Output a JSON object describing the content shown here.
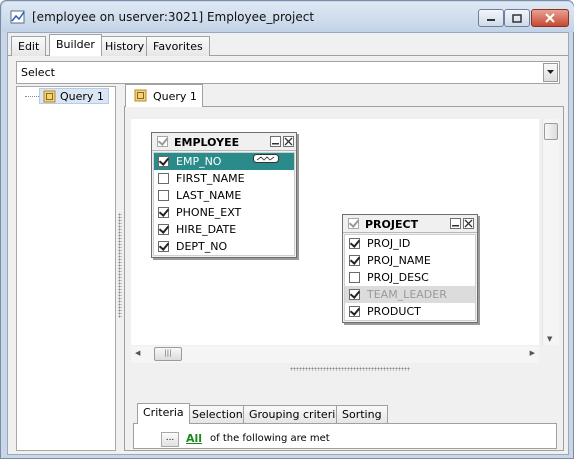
{
  "window": {
    "title": "[employee on userver:3021] Employee_project"
  },
  "tabs": [
    {
      "label": "Edit"
    },
    {
      "label": "Builder",
      "active": true
    },
    {
      "label": "History"
    },
    {
      "label": "Favorites"
    }
  ],
  "query_type": {
    "value": "Select"
  },
  "tree": {
    "items": [
      {
        "label": "Query 1"
      }
    ]
  },
  "query_tab": {
    "label": "Query 1"
  },
  "tables": [
    {
      "name": "EMPLOYEE",
      "fields": [
        {
          "name": "EMP_NO",
          "checked": true,
          "selected": true
        },
        {
          "name": "FIRST_NAME",
          "checked": false
        },
        {
          "name": "LAST_NAME",
          "checked": false
        },
        {
          "name": "PHONE_EXT",
          "checked": true
        },
        {
          "name": "HIRE_DATE",
          "checked": true
        },
        {
          "name": "DEPT_NO",
          "checked": true
        }
      ]
    },
    {
      "name": "PROJECT",
      "fields": [
        {
          "name": "PROJ_ID",
          "checked": true
        },
        {
          "name": "PROJ_NAME",
          "checked": true
        },
        {
          "name": "PROJ_DESC",
          "checked": false
        },
        {
          "name": "TEAM_LEADER",
          "checked": true,
          "dimmed": true
        },
        {
          "name": "PRODUCT",
          "checked": true
        }
      ]
    }
  ],
  "bottom_tabs": [
    {
      "label": "Criteria",
      "active": true
    },
    {
      "label": "Selection"
    },
    {
      "label": "Grouping criteria"
    },
    {
      "label": "Sorting"
    }
  ],
  "criteria": {
    "button_label": "...",
    "quantifier": "All",
    "text": "of the following are met"
  },
  "colors": {
    "selected_field_bg": "#2b8a8a",
    "criteria_link": "#1a8a1a",
    "close_button": "#c64a34"
  }
}
